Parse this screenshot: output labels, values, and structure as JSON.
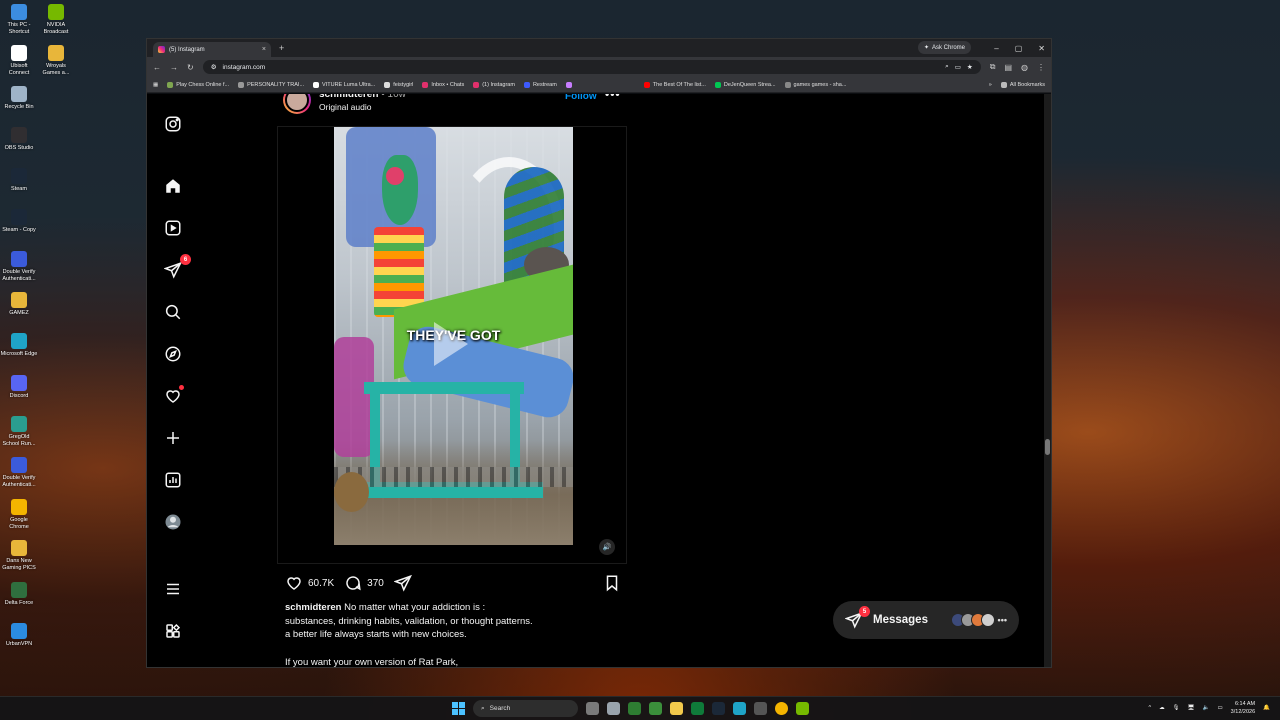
{
  "desktop_icons": [
    {
      "label": "This PC - Shortcut",
      "icon": "computer-icon",
      "color": "#3c8de0"
    },
    {
      "label": "NVIDIA Broadcast",
      "icon": "nvidia-icon",
      "color": "#76b900"
    },
    {
      "label": "Ubisoft Connect",
      "icon": "ubisoft-icon",
      "color": "#ffffff"
    },
    {
      "label": "Wroyals Games a...",
      "icon": "folder-icon",
      "color": "#e8b63a"
    },
    {
      "label": "Recycle Bin",
      "icon": "recycle-bin-icon",
      "color": "#9fb4c8"
    },
    {
      "label": "OBS Studio",
      "icon": "obs-icon",
      "color": "#302e31"
    },
    {
      "label": "Steam",
      "icon": "steam-icon",
      "color": "#1b2838"
    },
    {
      "label": "Steam - Copy",
      "icon": "steam-icon",
      "color": "#1b2838"
    },
    {
      "label": "Double Verify Authenticati...",
      "icon": "app-icon",
      "color": "#3b5bdb"
    },
    {
      "label": "GAMEZ",
      "icon": "folder-icon",
      "color": "#e8b63a"
    },
    {
      "label": "Microsoft Edge",
      "icon": "edge-icon",
      "color": "#1fa4c7"
    },
    {
      "label": "Discord",
      "icon": "discord-icon",
      "color": "#5865f2"
    },
    {
      "label": "GregOld School Run...",
      "icon": "app-icon",
      "color": "#2a9d8f"
    },
    {
      "label": "Double Verify Authenticati...",
      "icon": "app-icon",
      "color": "#3b5bdb"
    },
    {
      "label": "Google Chrome",
      "icon": "chrome-icon",
      "color": "#f4b400"
    },
    {
      "label": "Dans New Gaming PICS",
      "icon": "folder-icon",
      "color": "#e8b63a"
    },
    {
      "label": "Delta Force",
      "icon": "game-icon",
      "color": "#2f6f3e"
    },
    {
      "label": "UrbanVPN",
      "icon": "vpn-icon",
      "color": "#2b8be0"
    }
  ],
  "browser": {
    "tab_title": "(5) Instagram",
    "tab_close": "×",
    "new_tab": "+",
    "ask_chrome": "Ask Chrome",
    "window_controls": {
      "minimize": "–",
      "maximize": "▢",
      "close": "✕"
    },
    "url": "instagram.com",
    "bookmarks": [
      {
        "label": "Play Chess Online f...",
        "color": "#7fa650"
      },
      {
        "label": "PERSONALITY TRAI...",
        "color": "#999999"
      },
      {
        "label": "VITURE Luma Ultra...",
        "color": "#ffffff"
      },
      {
        "label": "feistygirl",
        "color": "#dddddd"
      },
      {
        "label": "Inbox • Chats",
        "color": "#e1306c"
      },
      {
        "label": "(1) Instagram",
        "color": "#e1306c"
      },
      {
        "label": "Restream",
        "color": "#3d5afe"
      },
      {
        "label": "",
        "color": "#c77dff"
      },
      {
        "label": "The Best Of The list...",
        "color": "#ff0000"
      },
      {
        "label": "DeJenQueen Strea...",
        "color": "#00c853"
      },
      {
        "label": "games games - sha...",
        "color": "#888888"
      }
    ],
    "all_bookmarks": "All Bookmarks",
    "bookmarks_overflow": "»"
  },
  "instagram": {
    "sidebar": [
      {
        "name": "instagram-logo-icon",
        "top": 0
      },
      {
        "name": "home-icon"
      },
      {
        "name": "reels-icon"
      },
      {
        "name": "messages-icon",
        "badge": "6"
      },
      {
        "name": "search-icon"
      },
      {
        "name": "explore-icon"
      },
      {
        "name": "notifications-icon"
      },
      {
        "name": "create-icon"
      },
      {
        "name": "dashboard-icon"
      },
      {
        "name": "profile-icon"
      },
      {
        "name": "menu-icon"
      },
      {
        "name": "also-from-meta-icon"
      }
    ],
    "post": {
      "username": "schmidteren",
      "time_ago": "10w",
      "separator": " • ",
      "audio": "Original audio",
      "follow": "Follow",
      "more": "•••",
      "video_caption": "THEY'VE GOT",
      "likes": "60.7K",
      "comments": "370",
      "caption_user": "schmidteren",
      "caption_line1": " No matter what your addiction is :",
      "caption_line2": "substances, drinking habits, validation, or thought patterns.",
      "caption_line3": "a better life always starts with new choices.",
      "caption_line4": "If you want your own version of Rat Park,"
    },
    "messages": {
      "label": "Messages",
      "badge": "5",
      "more": "•••"
    }
  },
  "taskbar": {
    "search_placeholder": "Search",
    "time": "6:14 AM",
    "date": "3/12/2026",
    "tray_arrow": "^"
  }
}
